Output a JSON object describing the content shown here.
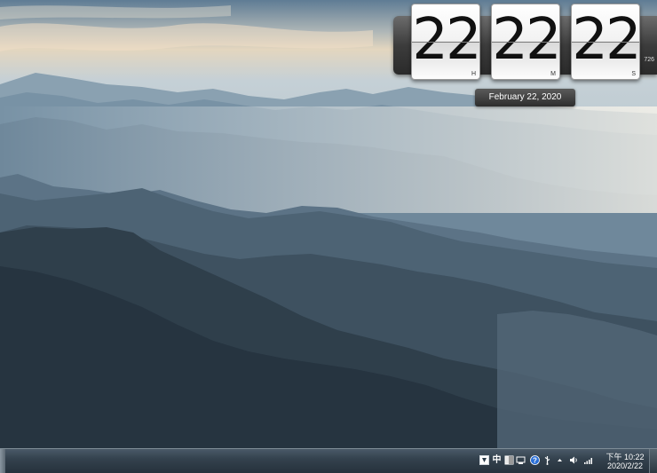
{
  "clock": {
    "hours": "22",
    "minutes": "22",
    "seconds": "22",
    "hours_label": "H",
    "minutes_label": "M",
    "seconds_label": "S",
    "extra": "726",
    "date": "February 22, 2020"
  },
  "taskbar": {
    "tray_icons": [
      "input-method-icon",
      "chinese-ime-icon",
      "ime-mode-icon",
      "network-manager-icon",
      "help-icon",
      "usb-icon",
      "show-hidden-icons-arrow",
      "volume-icon",
      "signal-icon"
    ],
    "ime_label": "中",
    "time": "下午 10:22",
    "date": "2020/2/22"
  }
}
